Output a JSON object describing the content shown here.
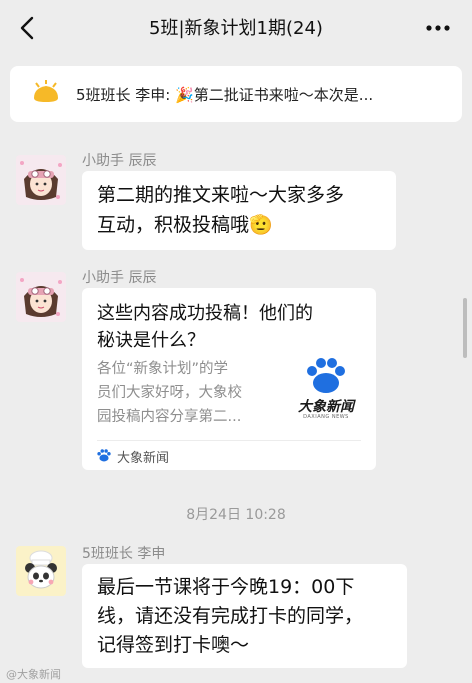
{
  "header": {
    "title": "5班|新象计划1期(24)"
  },
  "announcement": {
    "text": "5班班长 李申: 🎉第二批证书来啦～本次是..."
  },
  "messages": [
    {
      "sender": "小助手 辰辰",
      "lines": [
        "第二期的推文来啦～大家多多",
        "互动，积极投稿哦🫡"
      ]
    },
    {
      "sender": "小助手 辰辰",
      "card": {
        "title_lines": [
          "这些内容成功投稿！他们的",
          "秘诀是什么？"
        ],
        "desc_lines": [
          "各位“新象计划”的学",
          "员们大家好呀，大象校",
          "园投稿内容分享第二..."
        ],
        "thumb_text": "大象新闻",
        "thumb_subtext": "DAXIANG NEWS",
        "source": "大象新闻"
      }
    }
  ],
  "timestamp": "8月24日 10:28",
  "last_message": {
    "sender": "5班班长 李申",
    "lines": [
      "最后一节课将于今晚19：00下",
      "线，请还没有完成打卡的同学，",
      "记得签到打卡噢～"
    ]
  },
  "watermark": "@大象新闻"
}
